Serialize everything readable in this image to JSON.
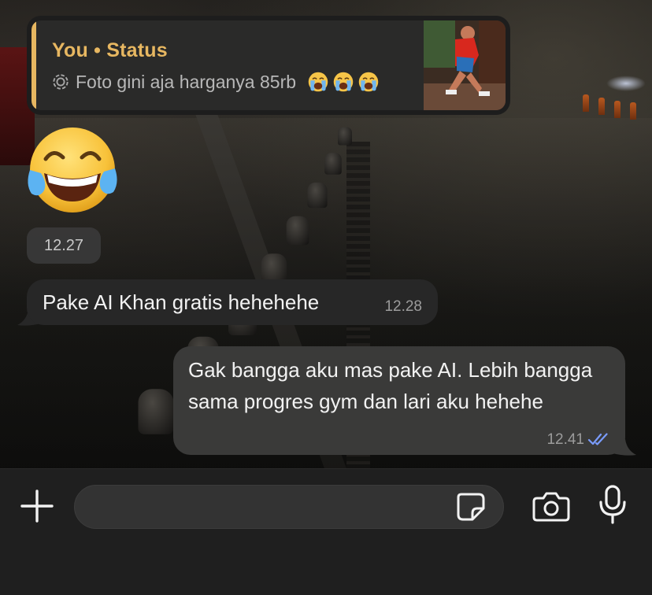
{
  "quoted_status": {
    "title": "You • Status",
    "caption": "Foto gini aja harganya 85rb",
    "reaction_emojis": [
      "crying-face",
      "crying-face",
      "crying-face"
    ],
    "accent_color": "#e7b761",
    "status_icon": "status-ring-icon",
    "thumbnail": "runner-photo"
  },
  "sticker": {
    "emoji": "face-with-tears-of-joy"
  },
  "time_divider": {
    "label": "12.27"
  },
  "messages": [
    {
      "direction": "incoming",
      "text": "Pake AI Khan gratis hehehehe",
      "time": "12.28"
    },
    {
      "direction": "outgoing",
      "text": "Gak bangga aku mas pake AI. Lebih bangga sama progres gym dan lari aku hehehe",
      "time": "12.41",
      "status": "read",
      "status_icon": "double-check-icon",
      "status_color": "#7a9cff"
    }
  ],
  "composer": {
    "value": "",
    "placeholder": "",
    "icons": [
      "plus-icon",
      "sticker-icon",
      "camera-icon",
      "microphone-icon"
    ]
  },
  "colors": {
    "incoming_bubble": "#272727",
    "outgoing_bubble": "#3a3a39",
    "input_bar": "#1f1f1f"
  }
}
